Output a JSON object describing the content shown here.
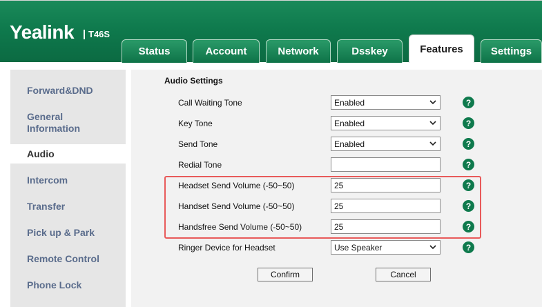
{
  "brand": {
    "logo": "Yealink",
    "model": "T46S"
  },
  "tabs": [
    {
      "label": "Status"
    },
    {
      "label": "Account"
    },
    {
      "label": "Network"
    },
    {
      "label": "Dsskey"
    },
    {
      "label": "Features",
      "active": true
    },
    {
      "label": "Settings"
    }
  ],
  "sidebar": {
    "items": [
      {
        "label": "Forward&DND"
      },
      {
        "label": "General Information"
      },
      {
        "label": "Audio",
        "active": true
      },
      {
        "label": "Intercom"
      },
      {
        "label": "Transfer"
      },
      {
        "label": "Pick up & Park"
      },
      {
        "label": "Remote Control"
      },
      {
        "label": "Phone Lock"
      }
    ]
  },
  "main": {
    "section_title": "Audio Settings",
    "rows": [
      {
        "label": "Call Waiting Tone",
        "type": "select",
        "value": "Enabled"
      },
      {
        "label": "Key Tone",
        "type": "select",
        "value": "Enabled"
      },
      {
        "label": "Send Tone",
        "type": "select",
        "value": "Enabled"
      },
      {
        "label": "Redial Tone",
        "type": "input",
        "value": ""
      },
      {
        "label": "Headset Send Volume (-50~50)",
        "type": "input",
        "value": "25"
      },
      {
        "label": "Handset Send Volume (-50~50)",
        "type": "input",
        "value": "25"
      },
      {
        "label": "Handsfree Send Volume (-50~50)",
        "type": "input",
        "value": "25"
      },
      {
        "label": "Ringer Device for Headset",
        "type": "select",
        "value": "Use Speaker"
      }
    ],
    "help_symbol": "?",
    "confirm_label": "Confirm",
    "cancel_label": "Cancel"
  },
  "colors": {
    "brand_green": "#0f7a4d",
    "highlight_red": "#e85a5a",
    "sidebar_text": "#5a6c8c"
  }
}
